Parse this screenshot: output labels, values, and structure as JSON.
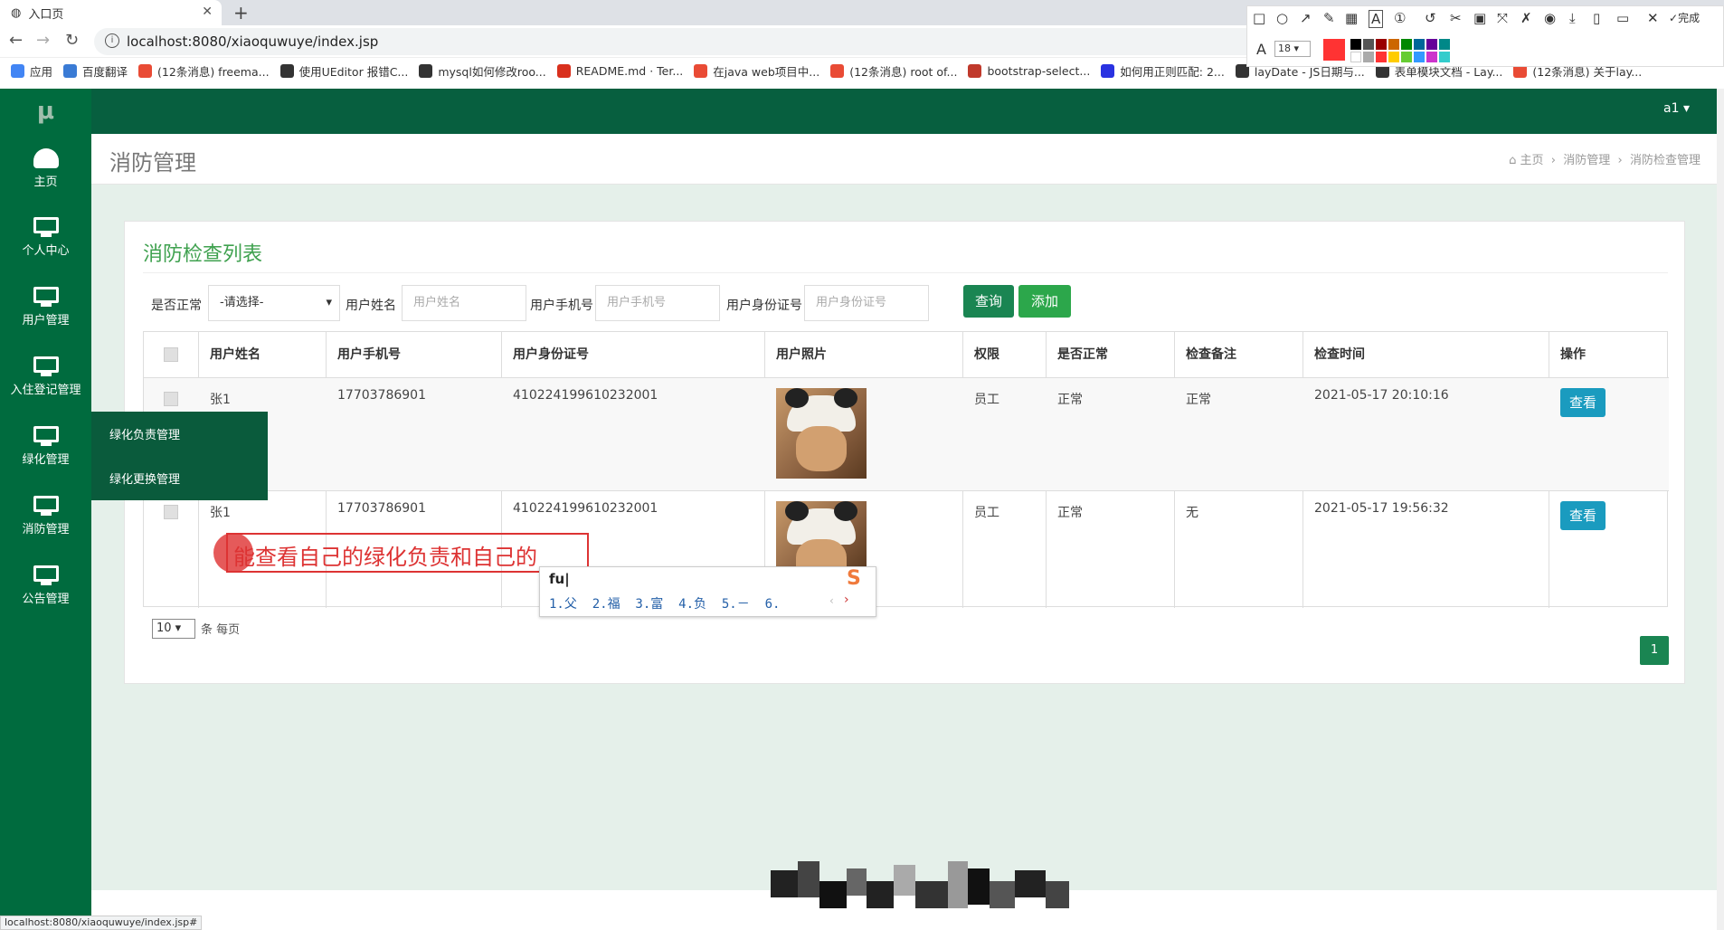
{
  "browser": {
    "tab_title": "入口页",
    "url": "localhost:8080/xiaoquwuye/index.jsp",
    "status_url": "localhost:8080/xiaoquwuye/index.jsp#",
    "bookmarks": [
      {
        "label": "应用",
        "color": "#4285f4"
      },
      {
        "label": "百度翻译",
        "color": "#3a7bd5"
      },
      {
        "label": "(12条消息) freema...",
        "color": "#e94b35"
      },
      {
        "label": "使用UEditor 报错C...",
        "color": "#333333"
      },
      {
        "label": "mysql如何修改roo...",
        "color": "#333333"
      },
      {
        "label": "README.md · Ter...",
        "color": "#d9301d"
      },
      {
        "label": "在java web项目中...",
        "color": "#e94b35"
      },
      {
        "label": "(12条消息) root of...",
        "color": "#e94b35"
      },
      {
        "label": "bootstrap-select...",
        "color": "#c0392b"
      },
      {
        "label": "如何用正则匹配: 2...",
        "color": "#2932e1"
      },
      {
        "label": "layDate - JS日期与...",
        "color": "#333333"
      },
      {
        "label": "表单模块文档 - Lay...",
        "color": "#333333"
      },
      {
        "label": "(12条消息) 关于lay...",
        "color": "#e94b35"
      }
    ],
    "annot_toolbar": {
      "font_size": "18",
      "done_label": "完成"
    }
  },
  "app": {
    "logo": "μ",
    "user": "a1 ▾",
    "sidebar": [
      {
        "label": "主页"
      },
      {
        "label": "个人中心"
      },
      {
        "label": "用户管理"
      },
      {
        "label": "入住登记管理"
      },
      {
        "label": "绿化管理"
      },
      {
        "label": "消防管理"
      },
      {
        "label": "公告管理"
      }
    ],
    "submenu": [
      "绿化负责管理",
      "绿化更换管理"
    ],
    "page_title": "消防管理",
    "breadcrumb": [
      "主页",
      "消防管理",
      "消防检查管理"
    ]
  },
  "panel": {
    "title": "消防检查列表",
    "filters": {
      "normal_label": "是否正常",
      "normal_value": "-请选择-",
      "name_label": "用户姓名",
      "name_placeholder": "用户姓名",
      "phone_label": "用户手机号",
      "phone_placeholder": "用户手机号",
      "id_label": "用户身份证号",
      "id_placeholder": "用户身份证号",
      "search_btn": "查询",
      "add_btn": "添加"
    },
    "columns": [
      "用户姓名",
      "用户手机号",
      "用户身份证号",
      "用户照片",
      "权限",
      "是否正常",
      "检查备注",
      "检查时间",
      "操作"
    ],
    "rows": [
      {
        "name": "张1",
        "phone": "17703786901",
        "idno": "410224199610232001",
        "role": "员工",
        "normal": "正常",
        "remark": "正常",
        "time": "2021-05-17 20:10:16",
        "action": "查看"
      },
      {
        "name": "张1",
        "phone": "17703786901",
        "idno": "410224199610232001",
        "role": "员工",
        "normal": "正常",
        "remark": "无",
        "time": "2021-05-17 19:56:32",
        "action": "查看"
      }
    ],
    "page_size": "10",
    "per_page_label": "条 每页",
    "page_no": "1"
  },
  "overlay": {
    "annotation_text": "能查看自己的绿化负责和自己的",
    "ime_code": "fu|",
    "ime_candidates": "1.父  2.福  3.富  4.负  5.－  6.",
    "ime_logo": "S"
  }
}
